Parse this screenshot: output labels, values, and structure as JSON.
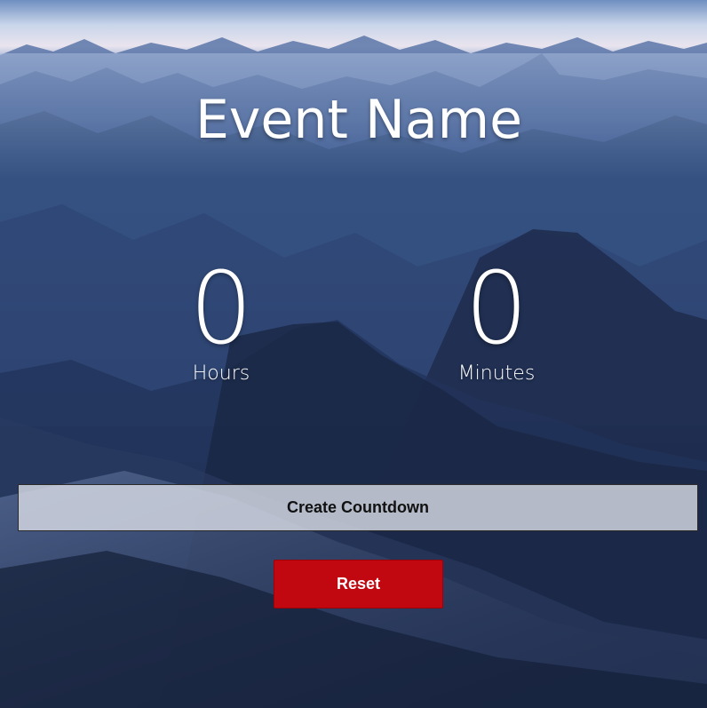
{
  "event": {
    "title": "Event Name"
  },
  "countdown": {
    "hours": {
      "value": "0",
      "label": "Hours"
    },
    "minutes": {
      "value": "0",
      "label": "Minutes"
    }
  },
  "actions": {
    "create_label": "Create Countdown",
    "reset_label": "Reset"
  },
  "colors": {
    "reset_button": "#c1070f",
    "create_button": "#d7dbe4",
    "text": "#ffffff"
  }
}
